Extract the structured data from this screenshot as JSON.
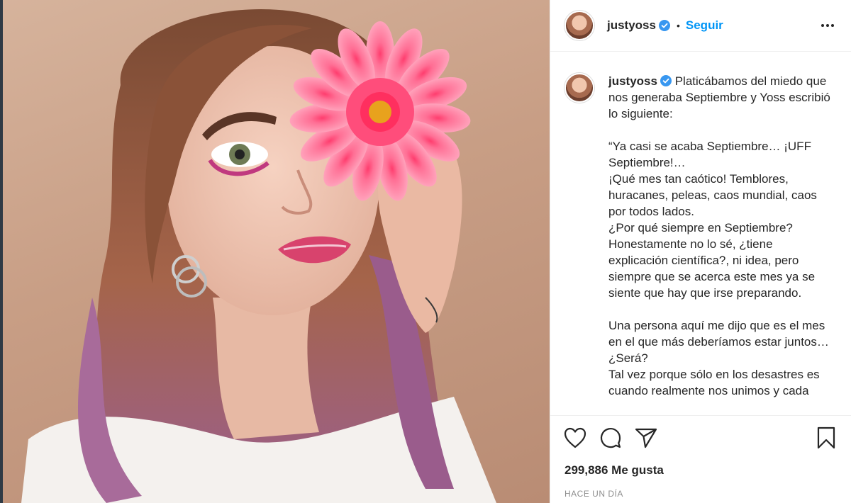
{
  "post": {
    "image_alt": "",
    "header": {
      "username": "justyoss",
      "separator": "•",
      "follow_label": "Seguir",
      "more_icon": "more-horizontal-icon"
    },
    "caption": {
      "username": "justyoss",
      "text": "Platicábamos del miedo que nos generaba Septiembre y Yoss escribió lo siguiente:\n\n“Ya casi se acaba Septiembre… ¡UFF Septiembre!…\n¡Qué mes tan caótico! Temblores, huracanes, peleas, caos mundial, caos por todos lados.\n¿Por qué siempre en Septiembre? Honestamente no lo sé, ¿tiene explicación científica?, ni idea, pero siempre que se acerca este mes ya se siente que hay que irse preparando.\n\nUna persona aquí me dijo que es el mes en el que más deberíamos estar juntos… ¿Será?\nTal vez porque sólo en los desastres es cuando realmente nos unimos y cada"
    },
    "actions": {
      "like_icon": "heart-icon",
      "comment_icon": "comment-icon",
      "share_icon": "paper-plane-icon",
      "save_icon": "bookmark-icon"
    },
    "likes_text": "299,886 Me gusta",
    "timestamp": "HACE UN DÍA",
    "colors": {
      "accent": "#0095f6",
      "verified": "#3897f0",
      "text": "#262626",
      "muted": "#8e8e8e",
      "divider": "#efefef"
    }
  }
}
